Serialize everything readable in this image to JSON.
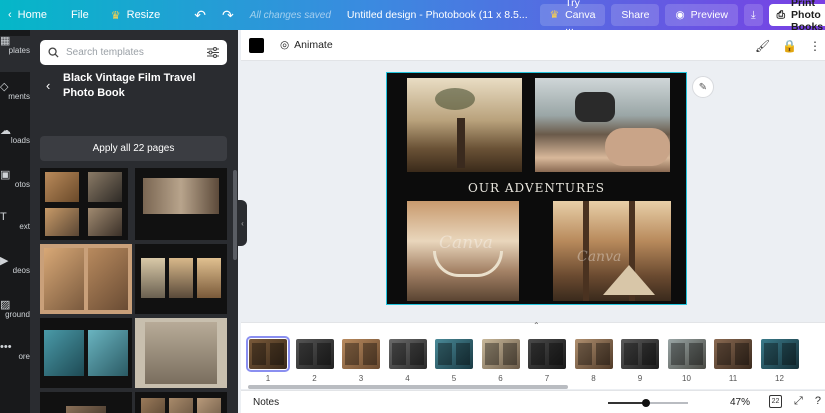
{
  "topbar": {
    "home": "Home",
    "file": "File",
    "resize": "Resize",
    "saved_status": "All changes saved",
    "design_title": "Untitled design - Photobook (11 x 8.5...",
    "try_canva": "Try Canva ...",
    "share": "Share",
    "preview": "Preview",
    "print": "Print Photo Books"
  },
  "rail": {
    "items": [
      "Templates",
      "Elements",
      "Uploads",
      "Photos",
      "Text",
      "Videos",
      "Background",
      "More"
    ],
    "visible_labels": [
      "plates",
      "ments",
      "loads",
      "otos",
      "ext",
      "deos",
      "ground",
      "ore"
    ]
  },
  "panel": {
    "search_placeholder": "Search templates",
    "template_title": "Black Vintage Film Travel Photo Book",
    "apply_label": "Apply all 22 pages"
  },
  "toolbar2": {
    "animate": "Animate"
  },
  "canvas": {
    "heading": "OUR ADVENTURES",
    "watermark": "Canva"
  },
  "strip": {
    "pages": [
      "1",
      "2",
      "3",
      "4",
      "5",
      "6",
      "7",
      "8",
      "9",
      "10",
      "11",
      "12"
    ],
    "active_page": 1
  },
  "bottombar": {
    "notes": "Notes",
    "zoom": "47%",
    "zoom_level": 0.47,
    "page_count": "22"
  },
  "colors": {
    "accent": "#22c4dc",
    "gradient_start": "#05b7c8",
    "gradient_end": "#7a3fe4",
    "panel_bg": "#2a2c30"
  }
}
